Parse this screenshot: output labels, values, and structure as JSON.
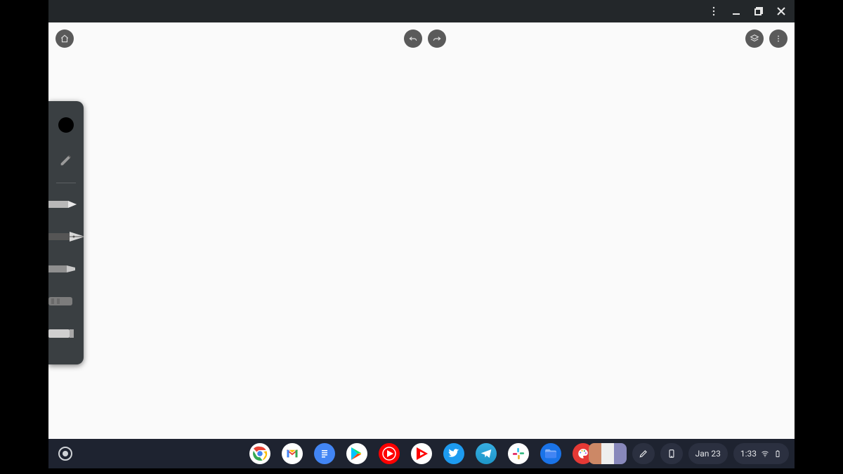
{
  "window": {
    "controls": [
      "kebab",
      "minimize",
      "restore",
      "close"
    ]
  },
  "canvasApp": {
    "buttons": {
      "home": "home",
      "undo": "undo",
      "redo": "redo",
      "layers": "layers",
      "menu": "menu"
    },
    "toolbox": {
      "currentColor": "#000000",
      "tools": [
        "pencil",
        "pen",
        "fountain-pen",
        "marker",
        "chisel",
        "eraser"
      ]
    }
  },
  "shelf": {
    "launcher": "launcher",
    "apps": [
      "chrome",
      "gmail",
      "docs",
      "play-store",
      "youtube-music",
      "youtube",
      "twitter",
      "telegram",
      "slack",
      "files",
      "paint"
    ],
    "preview": "tote-preview",
    "stylus": "stylus-tools",
    "phoneHub": "phone-hub",
    "date": "Jan 23",
    "time": "1:33",
    "statusIcons": [
      "wifi",
      "battery"
    ]
  }
}
